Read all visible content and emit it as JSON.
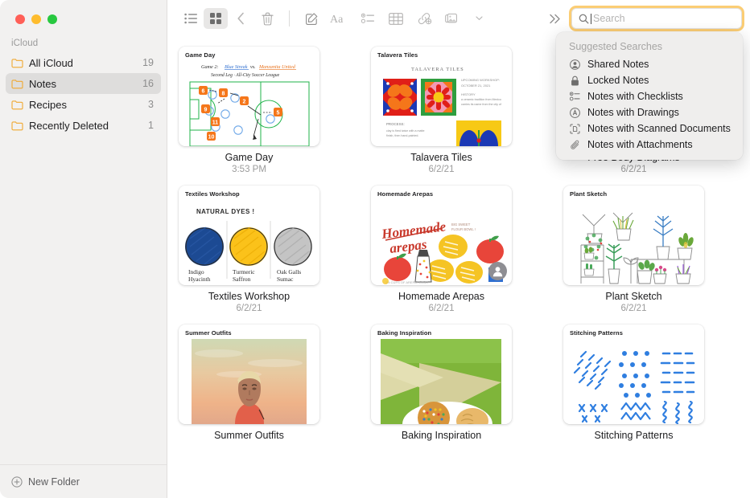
{
  "window": {
    "traffic_lights": [
      "close",
      "minimize",
      "zoom"
    ],
    "colors": {
      "close": "#ff5f57",
      "minimize": "#febc2e",
      "zoom": "#28c840",
      "folder_icon": "#f0a830",
      "accent_focus_ring": "#fac45c",
      "sidebar_bg": "#f2f1f0",
      "selection_bg": "#dedddc"
    }
  },
  "sidebar": {
    "section_label": "iCloud",
    "items": [
      {
        "label": "All iCloud",
        "count": "19",
        "selected": false
      },
      {
        "label": "Notes",
        "count": "16",
        "selected": true
      },
      {
        "label": "Recipes",
        "count": "3",
        "selected": false
      },
      {
        "label": "Recently Deleted",
        "count": "1",
        "selected": false
      }
    ],
    "new_folder_label": "New Folder"
  },
  "toolbar": {
    "items": [
      {
        "name": "list-view-icon",
        "label": "List View",
        "active": false
      },
      {
        "name": "gallery-view-icon",
        "label": "Gallery View",
        "active": true
      },
      {
        "name": "back-chevron-icon",
        "label": "Back",
        "active": false
      },
      {
        "name": "trash-icon",
        "label": "Delete",
        "active": false
      },
      {
        "name": "compose-icon",
        "label": "New Note",
        "active": false
      },
      {
        "name": "format-text-icon",
        "label": "Format",
        "active": false
      },
      {
        "name": "checklist-icon",
        "label": "Checklist",
        "active": false
      },
      {
        "name": "table-icon",
        "label": "Table",
        "active": false
      },
      {
        "name": "link-icon",
        "label": "Add Link",
        "active": false
      },
      {
        "name": "media-icon",
        "label": "Media",
        "active": false
      },
      {
        "name": "overflow-icon",
        "label": "More",
        "active": false
      }
    ]
  },
  "search": {
    "placeholder": "Search",
    "value": "",
    "focused": true
  },
  "suggestions": {
    "title": "Suggested Searches",
    "items": [
      {
        "icon": "shared-person-icon",
        "label": "Shared Notes"
      },
      {
        "icon": "lock-icon",
        "label": "Locked Notes"
      },
      {
        "icon": "checklist-icon",
        "label": "Notes with Checklists"
      },
      {
        "icon": "drawing-icon",
        "label": "Notes with Drawings"
      },
      {
        "icon": "scanned-document-icon",
        "label": "Notes with Scanned Documents"
      },
      {
        "icon": "paperclip-icon",
        "label": "Notes with Attachments"
      }
    ]
  },
  "notes": [
    {
      "header": "Game Day",
      "title": "Game Day",
      "date": "3:53 PM",
      "thumb": "soccer-play-diagram",
      "shared": false,
      "handwriting": {
        "line1": "Game 2:  Blue Streak  vs.  Manzanita United",
        "line2": "Second Leg · All-City Soccer League"
      }
    },
    {
      "header": "Talavera Tiles",
      "title": "Talavera Tiles",
      "date": "6/2/21",
      "thumb": "talavera-tiles",
      "shared": false,
      "inner_heading": "TALAVERA TILES"
    },
    {
      "header": "Free Body Diagrams",
      "title": "Free Body Diagrams",
      "date": "6/2/21",
      "thumb": "free-body-diagrams",
      "shared": false
    },
    {
      "header": "Textiles Workshop",
      "title": "Textiles Workshop",
      "date": "6/2/21",
      "thumb": "dye-swatches",
      "shared": false,
      "inner_heading": "NATURAL DYES !",
      "swatches": [
        {
          "name": "Indigo Hyacinth",
          "color": "#1c4a93"
        },
        {
          "name": "Turmeric Saffron",
          "color": "#fbc21a"
        },
        {
          "name": "Oak Galls Sumac",
          "color": "#b9b9b9"
        }
      ]
    },
    {
      "header": "Homemade Arepas",
      "title": "Homemade Arepas",
      "date": "6/2/21",
      "thumb": "arepas-illustration",
      "shared": true
    },
    {
      "header": "Plant Sketch",
      "title": "Plant Sketch",
      "date": "6/2/21",
      "thumb": "plant-sketch",
      "shared": false
    },
    {
      "header": "Summer Outfits",
      "title": "Summer Outfits",
      "date": "",
      "thumb": "portrait-photo",
      "shared": false
    },
    {
      "header": "Baking Inspiration",
      "title": "Baking Inspiration",
      "date": "",
      "thumb": "cookies-photo",
      "shared": false
    },
    {
      "header": "Stitching Patterns",
      "title": "Stitching Patterns",
      "date": "",
      "thumb": "stitch-patterns",
      "shared": false
    }
  ]
}
